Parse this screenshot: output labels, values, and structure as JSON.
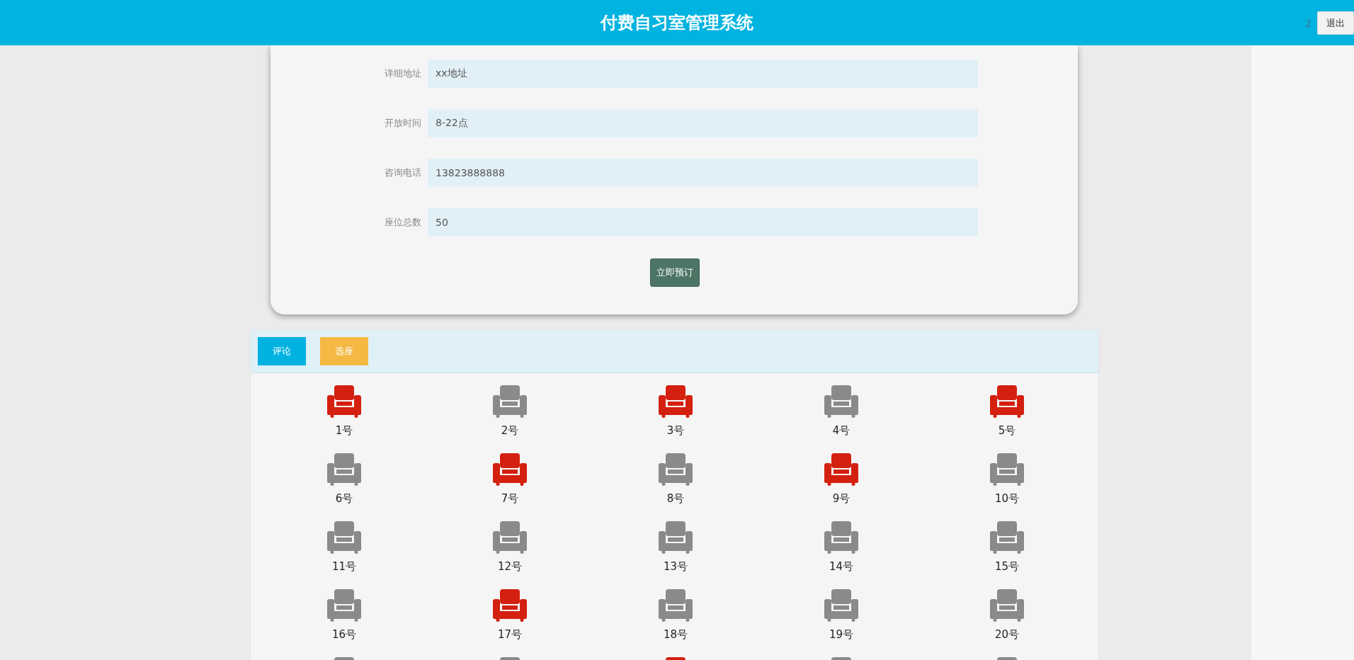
{
  "header": {
    "title": "付费自习室管理系统",
    "user": "2",
    "logout_button": "退出"
  },
  "form": {
    "fields": [
      {
        "label": "详细地址",
        "value": "xx地址"
      },
      {
        "label": "开放时间",
        "value": "8-22点"
      },
      {
        "label": "咨询电话",
        "value": "13823888888"
      },
      {
        "label": "座位总数",
        "value": "50"
      }
    ],
    "submit_button": "立即预订"
  },
  "tabs": [
    {
      "label": "评论",
      "color": "#00b2e2"
    },
    {
      "label": "选座",
      "color": "#f4b843"
    }
  ],
  "seats": [
    {
      "label": "1号",
      "occupied": true
    },
    {
      "label": "2号",
      "occupied": false
    },
    {
      "label": "3号",
      "occupied": true
    },
    {
      "label": "4号",
      "occupied": false
    },
    {
      "label": "5号",
      "occupied": true
    },
    {
      "label": "6号",
      "occupied": false
    },
    {
      "label": "7号",
      "occupied": true
    },
    {
      "label": "8号",
      "occupied": false
    },
    {
      "label": "9号",
      "occupied": true
    },
    {
      "label": "10号",
      "occupied": false
    },
    {
      "label": "11号",
      "occupied": false
    },
    {
      "label": "12号",
      "occupied": false
    },
    {
      "label": "13号",
      "occupied": false
    },
    {
      "label": "14号",
      "occupied": false
    },
    {
      "label": "15号",
      "occupied": false
    },
    {
      "label": "16号",
      "occupied": false
    },
    {
      "label": "17号",
      "occupied": true
    },
    {
      "label": "18号",
      "occupied": false
    },
    {
      "label": "19号",
      "occupied": false
    },
    {
      "label": "20号",
      "occupied": false
    },
    {
      "occupied": false
    },
    {
      "occupied": false
    },
    {
      "occupied": true
    },
    {
      "occupied": false
    },
    {
      "occupied": false
    }
  ]
}
